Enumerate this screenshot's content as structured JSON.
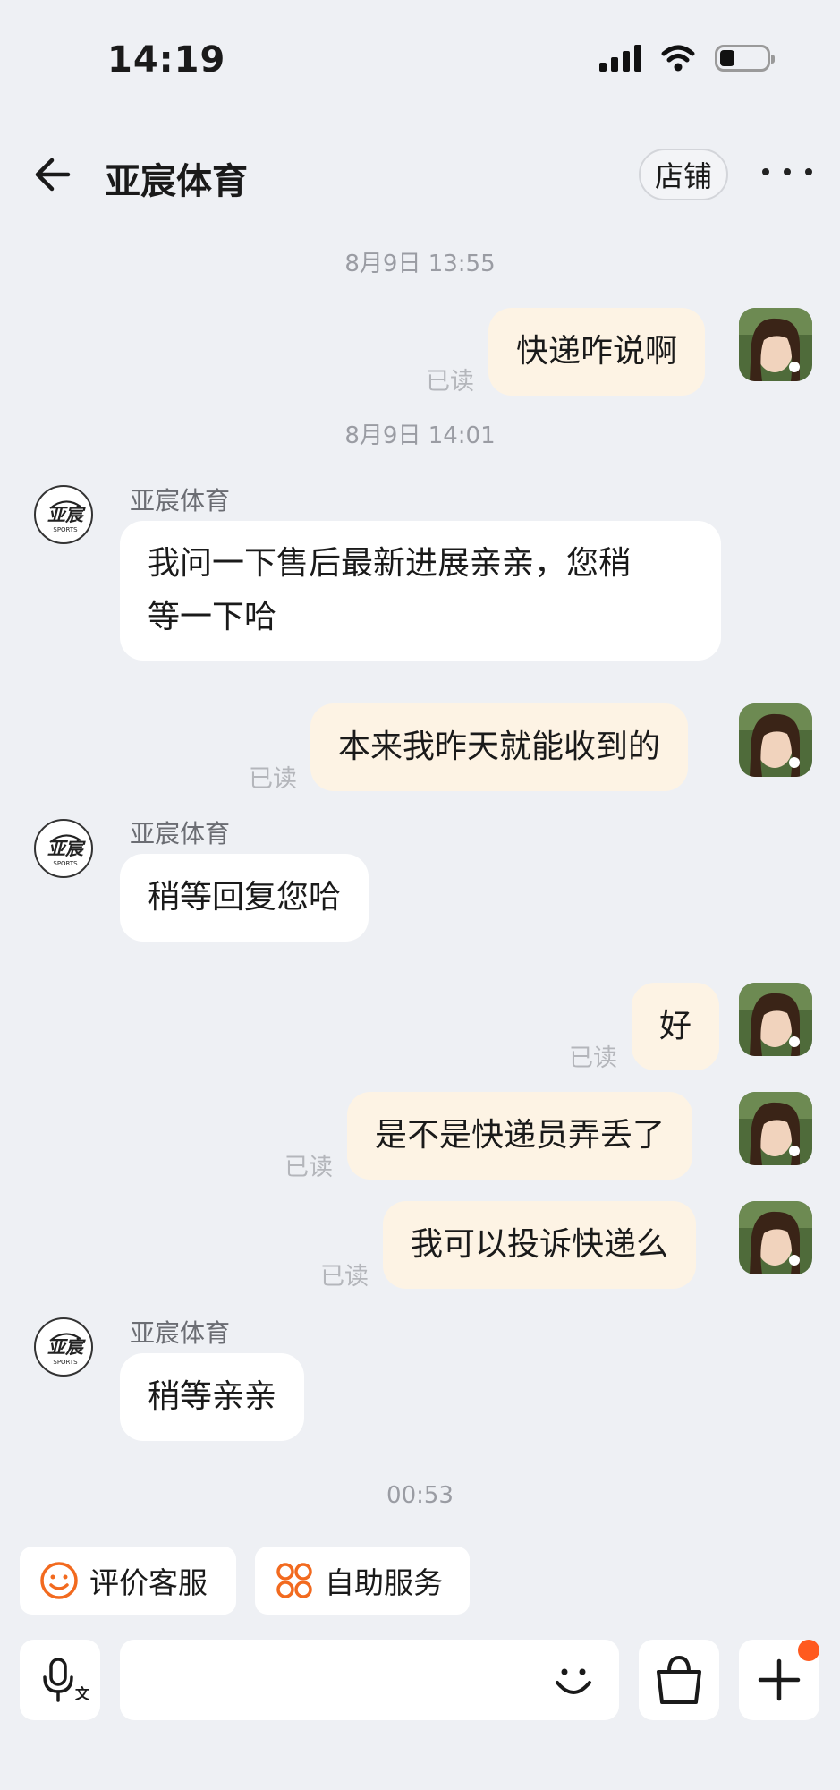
{
  "status_bar": {
    "time": "14:19"
  },
  "header": {
    "title": "亚宸体育",
    "shop_button": "店铺"
  },
  "messages": {
    "ts1": "8月9日 13:55",
    "m1": {
      "text": "快递咋说啊",
      "status": "已读"
    },
    "ts2": "8月9日 14:01",
    "m2": {
      "sender": "亚宸体育",
      "text_line1": "我问一下售后最新进展亲亲，您稍",
      "text_line2": "等一下哈"
    },
    "m3": {
      "text": "本来我昨天就能收到的",
      "status": "已读"
    },
    "m4": {
      "sender": "亚宸体育",
      "text": "稍等回复您哈"
    },
    "m5": {
      "text": "好",
      "status": "已读"
    },
    "m6": {
      "text": "是不是快递员弄丢了",
      "status": "已读"
    },
    "m7": {
      "text": "我可以投诉快递么",
      "status": "已读"
    },
    "m8": {
      "sender": "亚宸体育",
      "text": "稍等亲亲"
    },
    "ts3": "00:53"
  },
  "quick_actions": {
    "rate": "评价客服",
    "self_service": "自助服务"
  },
  "icons": {
    "back": "back-arrow-icon",
    "more": "more-icon",
    "voice": "microphone-icon",
    "emoji": "smile-icon",
    "bag": "shopping-bag-icon",
    "plus": "plus-icon"
  },
  "colors": {
    "accent": "#f26a1f",
    "my_bubble": "#fdf3e4",
    "their_bubble": "#ffffff",
    "background": "#eef0f4",
    "notification_dot": "#ff5a1f"
  }
}
